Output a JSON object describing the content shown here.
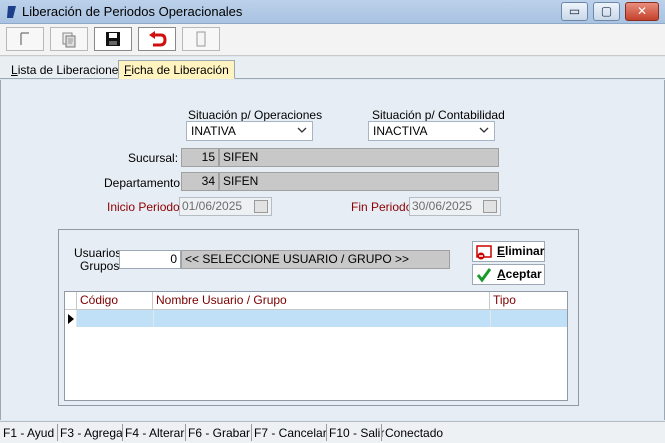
{
  "window": {
    "title": "Liberación de Periodos Operacionales",
    "controls": {
      "minimize": "▭",
      "maximize": "▢",
      "close": "✕"
    }
  },
  "toolbar": {
    "icons": [
      "new-icon",
      "copy-icon",
      "save-icon",
      "undo-icon",
      "document-icon"
    ]
  },
  "tabs": [
    {
      "label": "Lista de Liberaciones",
      "underline": "L",
      "rest": "ista de Liberaciones",
      "active": false
    },
    {
      "label": "Ficha de Liberación",
      "underline": "F",
      "rest": "icha de Liberación",
      "active": true
    }
  ],
  "form": {
    "situacion_operaciones": {
      "label": "Situación p/ Operaciones",
      "value": "INATIVA"
    },
    "situacion_contabilidad": {
      "label": "Situación p/ Contabilidad",
      "value": "INACTIVA"
    },
    "sucursal": {
      "label": "Sucursal:",
      "code": "15",
      "name": "SIFEN"
    },
    "departamento": {
      "label": "Departamento:",
      "code": "34",
      "name": "SIFEN"
    },
    "inicio_periodo": {
      "label": "Inicio Periodo:",
      "value": "01/06/2025"
    },
    "fin_periodo": {
      "label": "Fin Periodo",
      "value": "30/06/2025"
    }
  },
  "usuarios": {
    "label_line1": "Usuarios",
    "label_line2": "Grupos",
    "value": "0",
    "selector": "<< SELECCIONE USUARIO / GRUPO >>",
    "eliminar": {
      "underline": "E",
      "rest": "liminar"
    },
    "aceptar": {
      "underline": "A",
      "rest": "ceptar"
    }
  },
  "grid": {
    "columns": [
      "Código",
      "Nombre Usuario / Grupo",
      "Tipo"
    ],
    "rows": []
  },
  "status_bar": [
    "F1 - Ayud",
    "F3 - Agrega",
    "F4 - Alterar",
    "F6 - Grabar",
    "F7 - Cancelar",
    "F10 - Salir",
    "Conectado"
  ],
  "colors": {
    "accent_tab": "#fff4bf",
    "label_red": "#8b0000",
    "grid_selection": "#bfe0f7"
  }
}
